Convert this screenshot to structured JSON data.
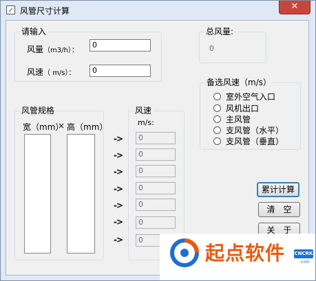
{
  "window": {
    "title": "风管尺寸计算",
    "close_glyph": "✕"
  },
  "input_group": {
    "title": "请输入",
    "airflow_label_main": "风量",
    "airflow_label_unit": "（m3/h）：",
    "airflow_value": "0",
    "velocity_label_main": "风速",
    "velocity_label_unit": "（ m/s）：",
    "velocity_value": "0"
  },
  "total_group": {
    "title": "总风量:",
    "value": "0"
  },
  "velocity_options": {
    "title": "备选风速（m/s）",
    "items": [
      "室外空气入口",
      "风机出口",
      "主风管",
      "支风管（水平）",
      "支风管（垂直）"
    ]
  },
  "duct_group": {
    "title": "风管规格",
    "width_label": "宽（mm）",
    "times": "×",
    "height_label": "高（mm）"
  },
  "speed_group": {
    "title": "风速",
    "unit": "m/s:",
    "values": [
      "0",
      "0",
      "0",
      "0",
      "0",
      "0",
      "0"
    ]
  },
  "arrow": "->",
  "buttons": {
    "calc": "累计计算",
    "clear": "清　空",
    "about": "关　于"
  },
  "watermark": {
    "text": "起点软件",
    "badge": "CNCRK",
    "badge_sub": "·com"
  },
  "icons": {
    "app": "window-app-icon",
    "close": "close-icon",
    "radio": "radio-icon"
  }
}
